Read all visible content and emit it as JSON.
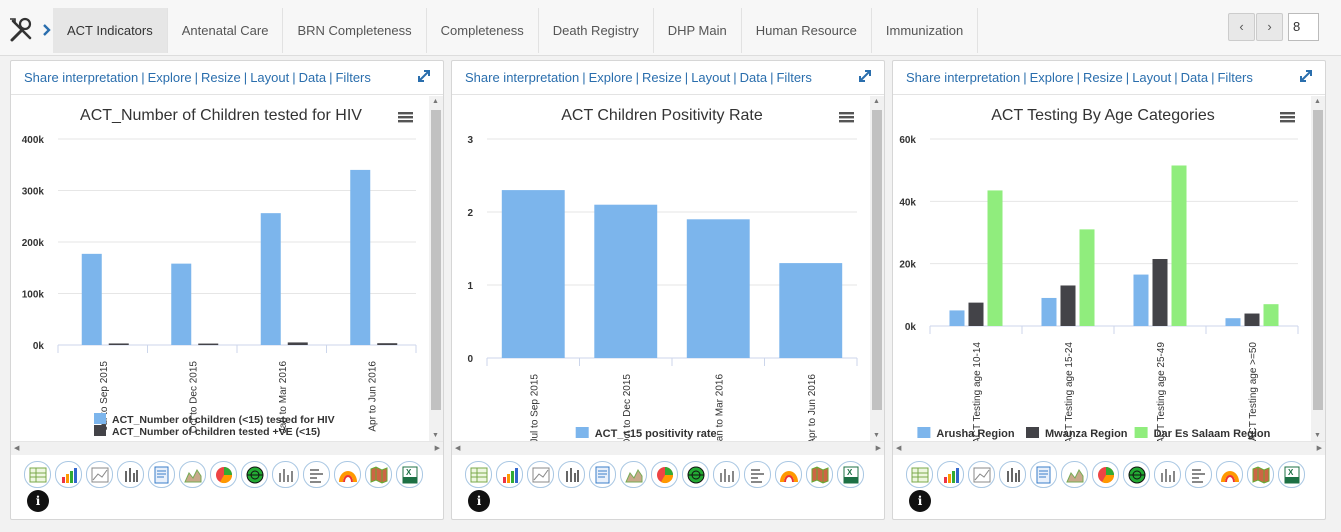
{
  "tabs": [
    {
      "label": "ACT Indicators",
      "active": true
    },
    {
      "label": "Antenatal Care"
    },
    {
      "label": "BRN Completeness"
    },
    {
      "label": "Completeness"
    },
    {
      "label": "Death Registry"
    },
    {
      "label": "DHP Main"
    },
    {
      "label": "Human Resource"
    },
    {
      "label": "Immunization"
    }
  ],
  "pager": {
    "prev": "‹",
    "next": "›",
    "page": "8"
  },
  "panel_links": [
    "Share interpretation",
    "Explore",
    "Resize",
    "Layout",
    "Data",
    "Filters"
  ],
  "panels": [
    {
      "title": "ACT_Number of Children tested for HIV"
    },
    {
      "title": "ACT Children Positivity Rate"
    },
    {
      "title": "ACT Testing By Age Categories"
    }
  ],
  "colors": {
    "blue": "#7cb5ec",
    "dark": "#434348",
    "green": "#90ed7d",
    "link": "#2a6ead"
  },
  "chart_data": [
    {
      "type": "bar",
      "title": "ACT_Number of Children tested for HIV",
      "categories": [
        "Jul to Sep 2015",
        "Oct to Dec 2015",
        "Jan to Mar 2016",
        "Apr to Jun 2016"
      ],
      "ytick_labels": [
        "0k",
        "100k",
        "200k",
        "300k",
        "400k"
      ],
      "ylim": [
        0,
        400000
      ],
      "series": [
        {
          "name": "ACT_Number of children (<15) tested for HIV",
          "values": [
            177000,
            158000,
            256000,
            340000
          ],
          "color": "#7cb5ec"
        },
        {
          "name": "ACT_Number of children tested +VE (<15)",
          "values": [
            3000,
            2800,
            5000,
            3500
          ],
          "color": "#434348"
        }
      ],
      "legend": "bottom"
    },
    {
      "type": "bar",
      "title": "ACT Children Positivity Rate",
      "categories": [
        "Jul to Sep 2015",
        "Oct to Dec 2015",
        "Jan to Mar 2016",
        "Apr to Jun 2016"
      ],
      "ytick_labels": [
        "0",
        "1",
        "2",
        "3"
      ],
      "ylim": [
        0,
        3
      ],
      "series": [
        {
          "name": "ACT_<15 positivity rate",
          "values": [
            2.3,
            2.1,
            1.9,
            1.3
          ],
          "color": "#7cb5ec"
        }
      ],
      "legend": "bottom"
    },
    {
      "type": "bar",
      "title": "ACT Testing By Age Categories",
      "categories": [
        "ACT Testing age 10-14",
        "ACT Testing age 15-24",
        "ACT Testing age 25-49",
        "ACT Testing age >=50"
      ],
      "ytick_labels": [
        "0k",
        "20k",
        "40k",
        "60k"
      ],
      "ylim": [
        0,
        60000
      ],
      "series": [
        {
          "name": "Arusha Region",
          "values": [
            5000,
            9000,
            16500,
            2500
          ],
          "color": "#7cb5ec"
        },
        {
          "name": "Mwanza Region",
          "values": [
            7500,
            13000,
            21500,
            4000
          ],
          "color": "#434348"
        },
        {
          "name": "Dar Es Salaam Region",
          "values": [
            43500,
            31000,
            51500,
            7000
          ],
          "color": "#90ed7d"
        }
      ],
      "legend": "bottom"
    }
  ],
  "toolbar_icons": [
    "table-icon",
    "column-chart-icon",
    "line-chart-icon",
    "stacked-column-icon",
    "list-icon",
    "area-chart-icon",
    "pie-chart-icon",
    "radar-icon",
    "bar-chart-icon",
    "stacked-bar-icon",
    "gauge-icon",
    "map-icon",
    "excel-icon"
  ],
  "info_label": "i"
}
